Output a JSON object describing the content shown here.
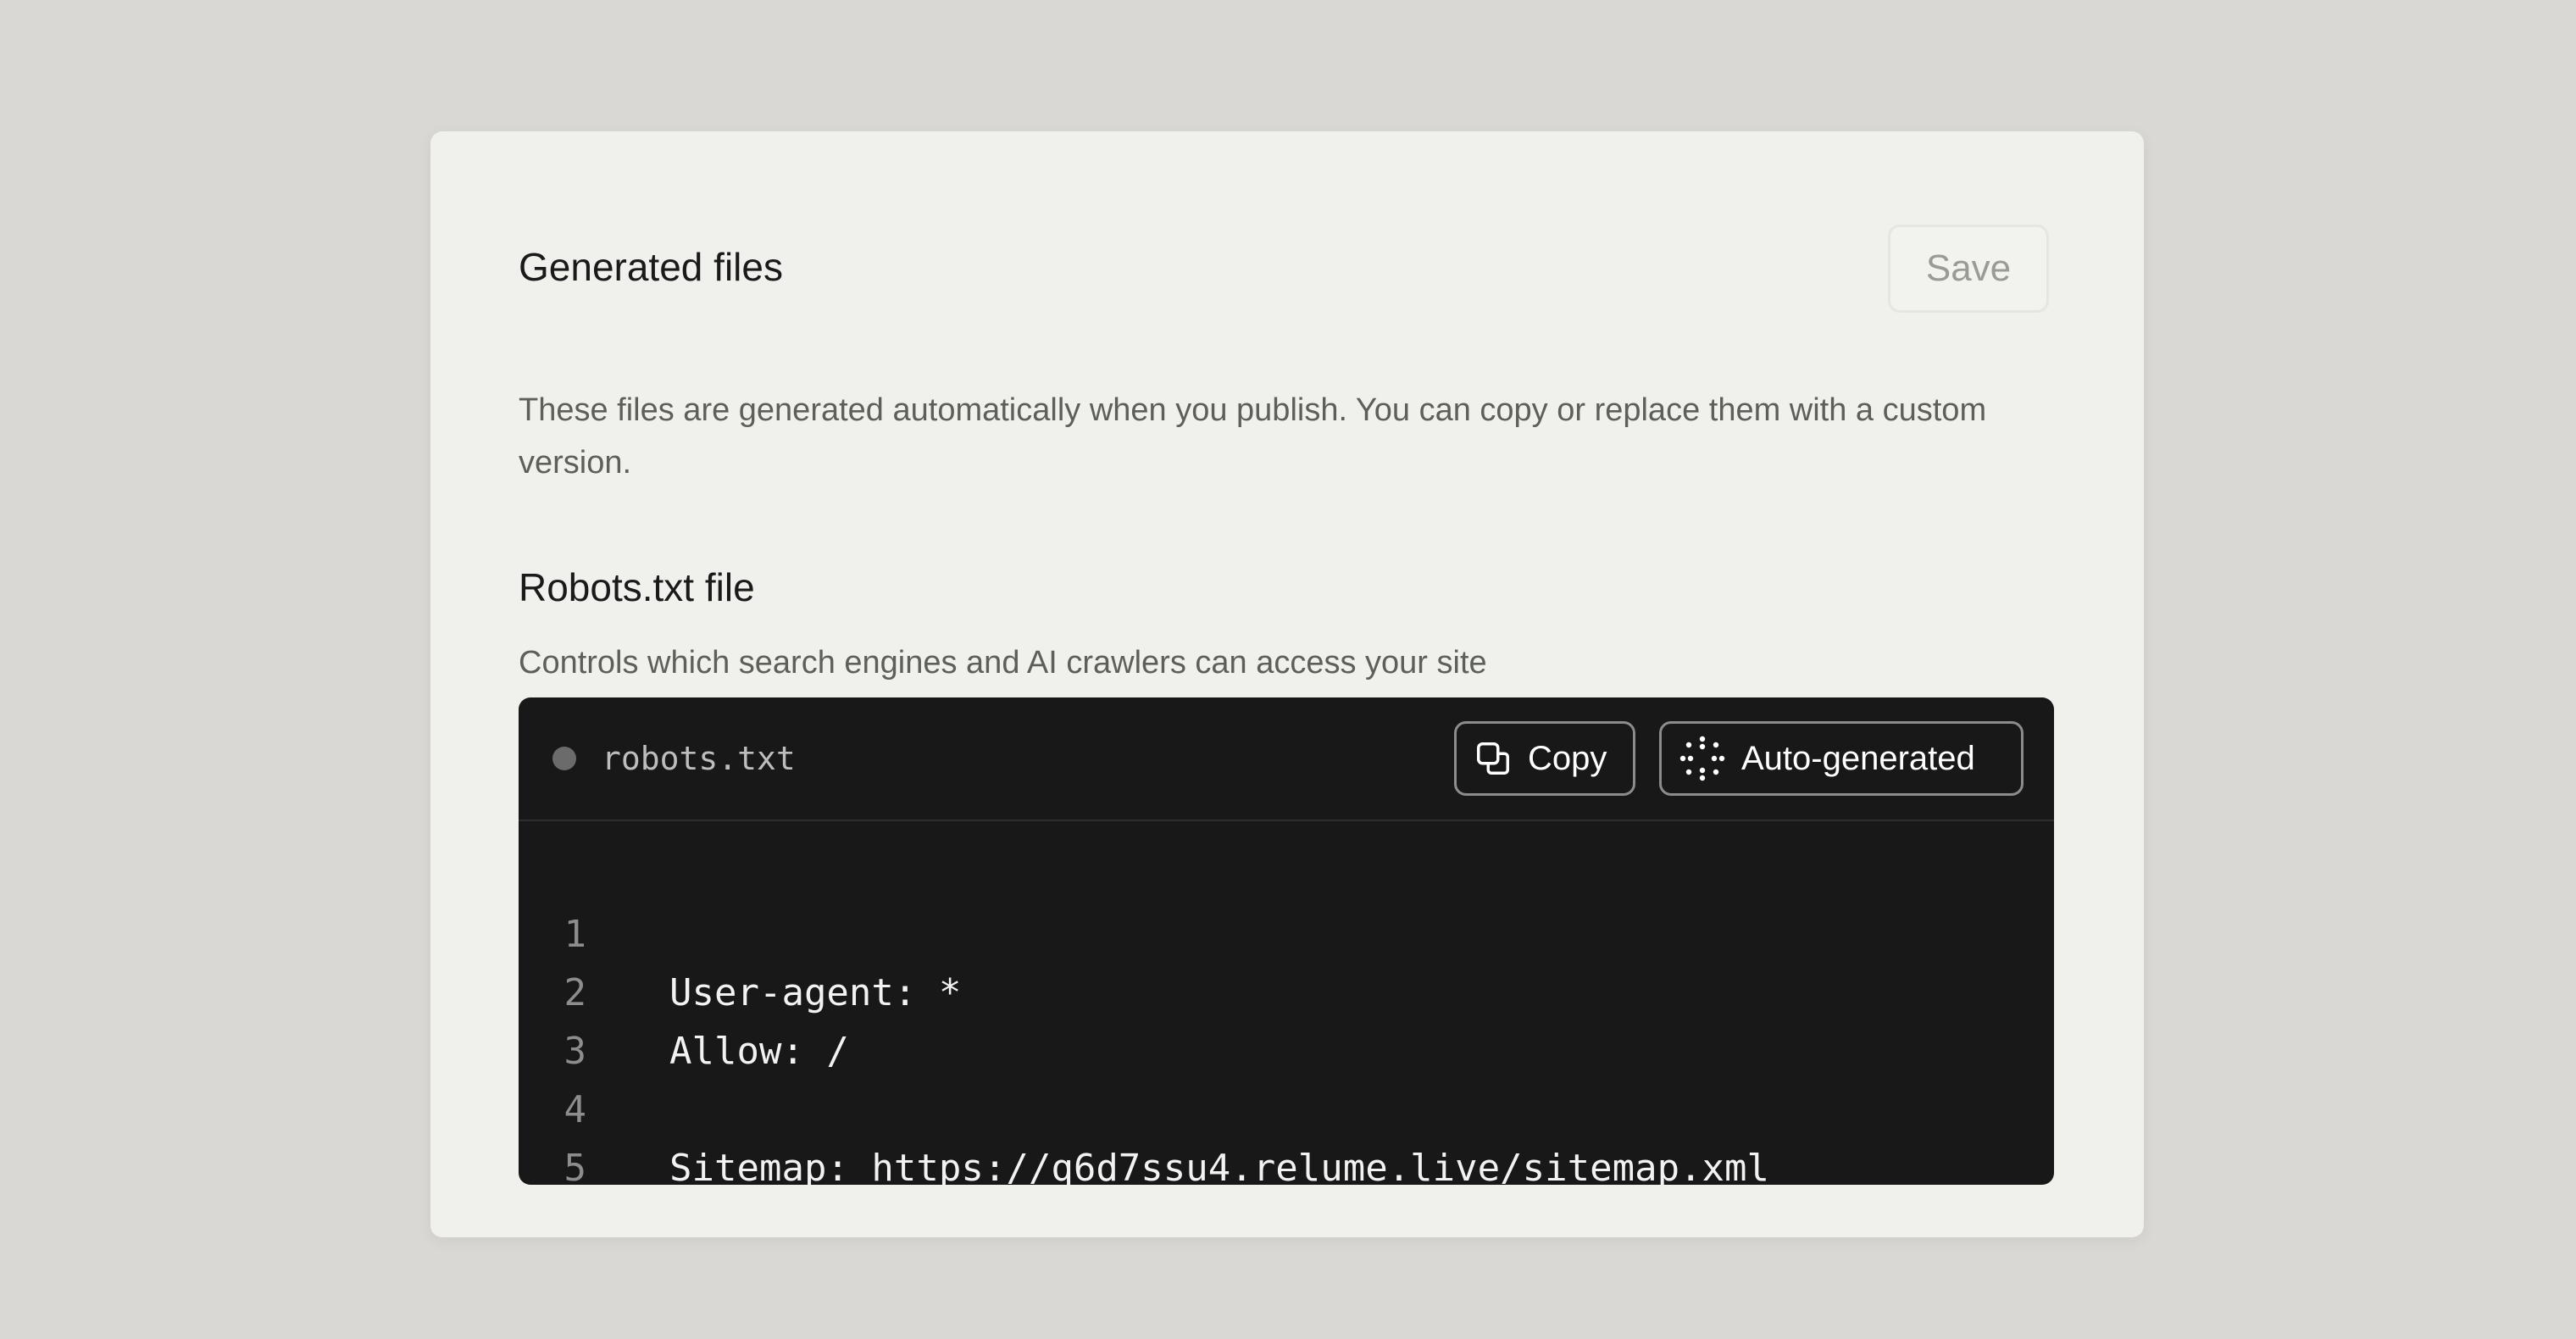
{
  "card": {
    "title": "Generated files",
    "save_label": "Save",
    "description": "These files are generated automatically when you publish. You can copy or replace them with a custom version."
  },
  "robots": {
    "title": "Robots.txt file",
    "description": "Controls which search engines and AI crawlers can access your site",
    "editor": {
      "filename": "robots.txt",
      "copy_label": "Copy",
      "copy_icon": "copy-icon",
      "auto_label": "Auto-generated",
      "auto_icon": "sparkle-dots-icon",
      "lines": [
        {
          "num": "1",
          "text": "User-agent: *"
        },
        {
          "num": "2",
          "text": "Allow: /"
        },
        {
          "num": "3",
          "text": ""
        },
        {
          "num": "4",
          "text": "Sitemap: https://q6d7ssu4.relume.live/sitemap.xml"
        },
        {
          "num": "5",
          "text": ""
        }
      ]
    }
  },
  "colors": {
    "page_background": "#d9d8d4",
    "card_background": "#f0f0ec",
    "editor_background": "#181818",
    "text_primary": "#1a1a1a",
    "text_secondary": "#5e5e5b"
  }
}
